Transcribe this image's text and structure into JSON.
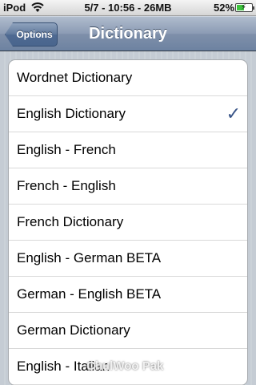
{
  "statusbar": {
    "carrier": "iPod",
    "time": "5/7 - 10:56 - 26MB",
    "battery_pct": "52%",
    "battery_level": 0.52
  },
  "navbar": {
    "back_label": "Options",
    "title": "Dictionary"
  },
  "list": {
    "items": [
      {
        "label": "Wordnet Dictionary",
        "checked": false
      },
      {
        "label": "English Dictionary",
        "checked": true
      },
      {
        "label": "English - French",
        "checked": false
      },
      {
        "label": "French - English",
        "checked": false
      },
      {
        "label": "French Dictionary",
        "checked": false
      },
      {
        "label": "English - German BETA",
        "checked": false
      },
      {
        "label": "German - English BETA",
        "checked": false
      },
      {
        "label": "German Dictionary",
        "checked": false
      },
      {
        "label": "English - Italian",
        "checked": false
      }
    ],
    "check_glyph": "✓"
  },
  "watermark": "ChulWoo Pak"
}
